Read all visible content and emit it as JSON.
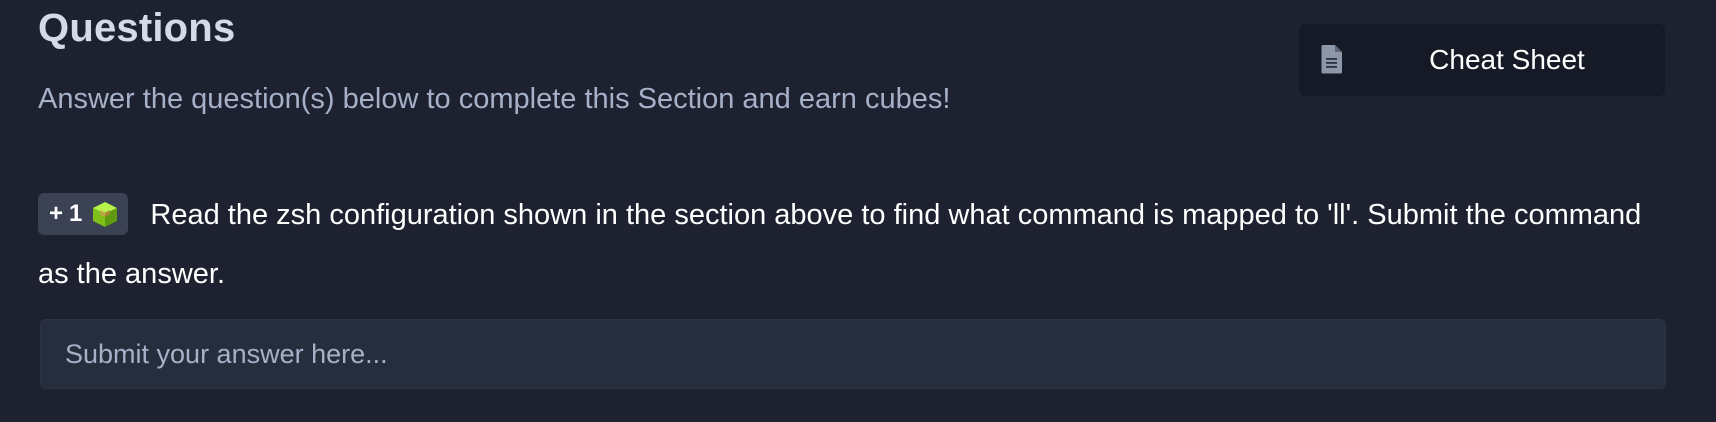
{
  "section": {
    "title": "Questions",
    "subtitle": "Answer the question(s) below to complete this Section and earn cubes!"
  },
  "cheat_sheet": {
    "label": "Cheat Sheet",
    "icon": "document-icon"
  },
  "question": {
    "badge_plus": "+",
    "badge_value": "1",
    "badge_icon": "cube-icon",
    "text": "Read the zsh configuration shown in the section above to find what command is mapped to 'll'. Submit the command as the answer."
  },
  "answer": {
    "placeholder": "Submit your answer here...",
    "value": ""
  },
  "colors": {
    "background": "#1e2230",
    "button_bg": "#151a26",
    "input_bg": "#262e3e",
    "badge_bg": "#3a4254",
    "cube_green": "#9fef00"
  }
}
